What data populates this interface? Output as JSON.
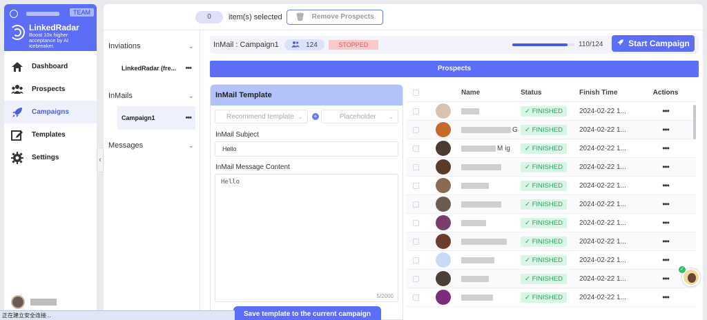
{
  "sidebar": {
    "team_badge": "TEAM",
    "brand_name": "LinkedRadar",
    "brand_tagline": "Boost 10x higher acceptance by AI icebreaker.",
    "nav": [
      {
        "label": "Dashboard",
        "icon": "home-icon",
        "active": false
      },
      {
        "label": "Prospects",
        "icon": "users-icon",
        "active": false
      },
      {
        "label": "Campaigns",
        "icon": "rocket-icon",
        "active": true
      },
      {
        "label": "Templates",
        "icon": "template-edit-icon",
        "active": false
      },
      {
        "label": "Settings",
        "icon": "gear-icon",
        "active": false
      }
    ],
    "colors": {
      "brand": "#5b6ef5",
      "active_bg": "#eef0fb",
      "active_text": "#4f5fd9"
    }
  },
  "statusbar": {
    "text": "正在建立安全连接..."
  },
  "topbar": {
    "selected_count": "0",
    "selected_text": "item(s) selected",
    "remove_label": "Remove Prospects"
  },
  "campaign_list": {
    "groups": [
      {
        "label": "Inviations",
        "items": [
          {
            "label": "LinkedRadar (fre...",
            "selected": false
          }
        ]
      },
      {
        "label": "InMails",
        "items": [
          {
            "label": "Campaign1",
            "selected": true
          }
        ]
      },
      {
        "label": "Messages",
        "items": []
      }
    ]
  },
  "campaign": {
    "title": "InMail : Campaign1",
    "people_count": "124",
    "status": "STOPPED",
    "progress_fraction": 0.887,
    "progress_text": "110/124",
    "start_label": "Start Campaign"
  },
  "prospects_banner": "Prospects",
  "template": {
    "header": "InMail Template",
    "recommend_placeholder": "Recommend template",
    "placeholder_select": "Placeholder",
    "subject_label": "InMail Subject",
    "subject_value": "Hello",
    "message_label": "InMail Message Content",
    "message_value": "Hello",
    "char_count": "5/2000",
    "save_label": "Save template to the current campaign"
  },
  "table": {
    "headers": {
      "name": "Name",
      "status": "Status",
      "finish_time": "Finish Time",
      "actions": "Actions"
    },
    "rows": [
      {
        "name": "",
        "status": "FINISHED",
        "time": "2024-02-22 1...",
        "avatar_color": "#d9c3b0"
      },
      {
        "name": "G",
        "status": "FINISHED",
        "time": "2024-02-22 1...",
        "avatar_color": "#c46a2d"
      },
      {
        "name": "M ig",
        "status": "FINISHED",
        "time": "2024-02-22 1...",
        "avatar_color": "#4a3b33"
      },
      {
        "name": "",
        "status": "FINISHED",
        "time": "2024-02-22 1...",
        "avatar_color": "#5a3a2a"
      },
      {
        "name": "",
        "status": "FINISHED",
        "time": "2024-02-22 1...",
        "avatar_color": "#8a6a55"
      },
      {
        "name": "",
        "status": "FINISHED",
        "time": "2024-02-22 1...",
        "avatar_color": "#6a5a50"
      },
      {
        "name": "",
        "status": "FINISHED",
        "time": "2024-02-22 1...",
        "avatar_color": "#7a3c6a"
      },
      {
        "name": "",
        "status": "FINISHED",
        "time": "2024-02-22 1...",
        "avatar_color": "#6b3b2b"
      },
      {
        "name": "",
        "status": "FINISHED",
        "time": "2024-02-22 1...",
        "avatar_color": "#c9d9f7"
      },
      {
        "name": "",
        "status": "FINISHED",
        "time": "2024-02-22 1...",
        "avatar_color": "#4b3f3a"
      },
      {
        "name": "",
        "status": "FINISHED",
        "time": "2024-02-22 1...",
        "avatar_color": "#7a2d7a"
      }
    ]
  }
}
